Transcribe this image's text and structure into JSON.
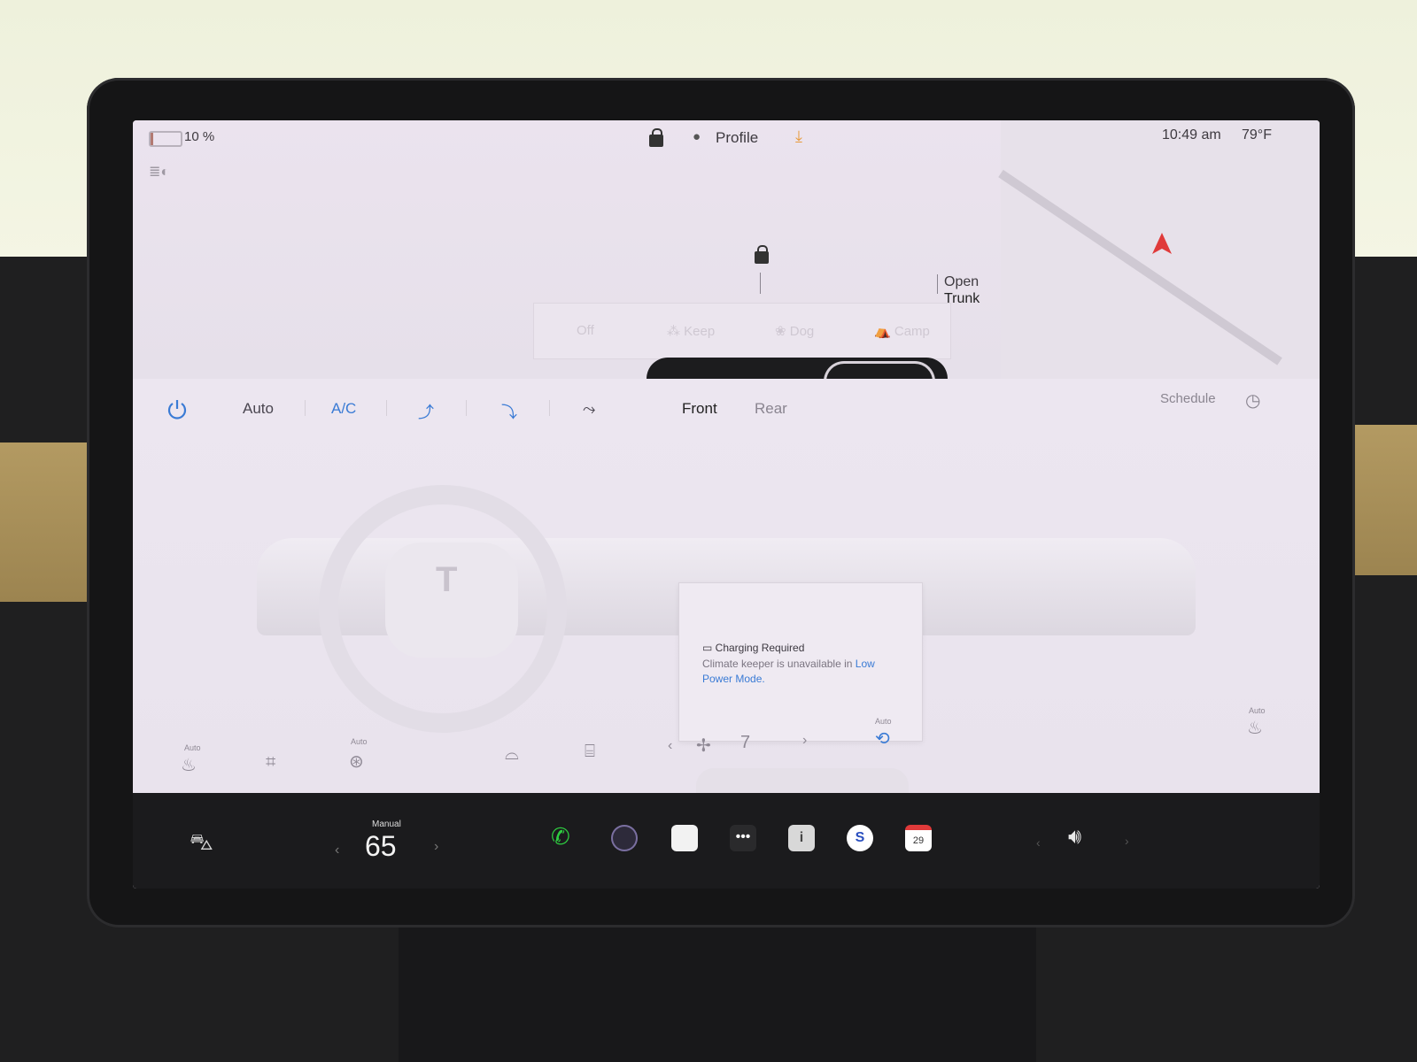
{
  "status_bar": {
    "battery_percent": "10 %",
    "battery_level": 0.1,
    "profile_label": "Profile",
    "time": "10:49 am",
    "temperature": "79°F"
  },
  "vehicle": {
    "trunk_label_line1": "Open",
    "trunk_label_line2": "Trunk"
  },
  "climate_modes": [
    "Off",
    "Keep",
    "Dog",
    "Camp"
  ],
  "climate_controls": {
    "auto_label": "Auto",
    "ac_label": "A/C",
    "front_label": "Front",
    "rear_label": "Rear",
    "schedule_label": "Schedule",
    "fan_speed": "7"
  },
  "notice": {
    "title": "Charging Required",
    "body": "Climate keeper is unavailable in ",
    "link": "Low Power Mode."
  },
  "bottom_icons": {
    "auto_label": "Auto"
  },
  "dock": {
    "manual_label": "Manual",
    "cabin_temp": "65",
    "calendar_day": "29"
  },
  "colors": {
    "accent_blue": "#3a7bd5",
    "nav_arrow": "#e03a3a",
    "download_orange": "#e89a3a",
    "phone_green": "#2ecc40"
  }
}
